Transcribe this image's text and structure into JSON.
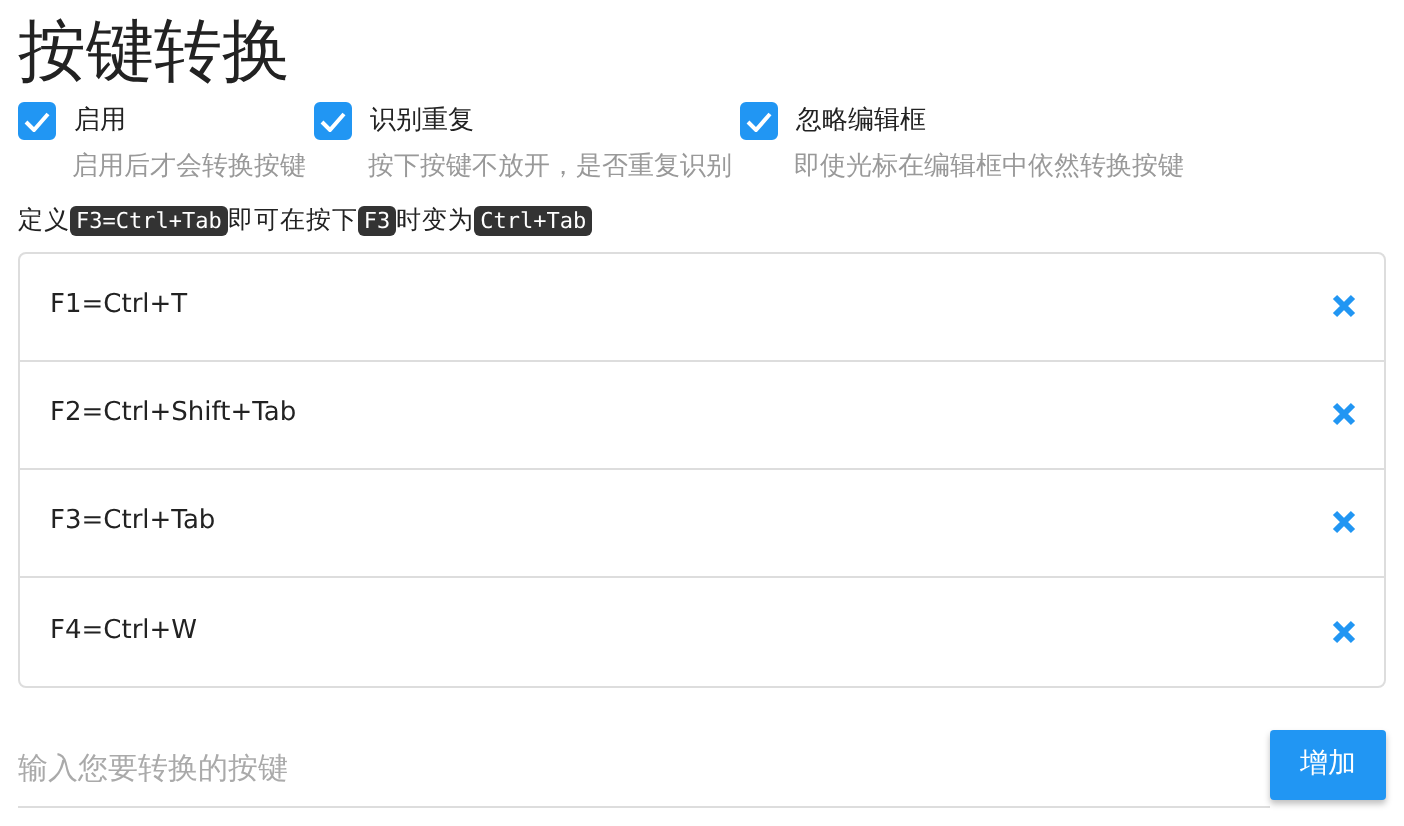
{
  "title": "按键转换",
  "options": [
    {
      "label": "启用",
      "hint": "启用后才会转换按键",
      "checked": true
    },
    {
      "label": "识别重复",
      "hint": "按下按键不放开，是否重复识别",
      "checked": true
    },
    {
      "label": "忽略编辑框",
      "hint": "即使光标在编辑框中依然转换按键",
      "checked": true
    }
  ],
  "help": [
    {
      "kind": "text",
      "text": "定义"
    },
    {
      "kind": "code",
      "text": "F3=Ctrl+Tab"
    },
    {
      "kind": "text",
      "text": "即可在按下"
    },
    {
      "kind": "code",
      "text": "F3"
    },
    {
      "kind": "text",
      "text": "时变为"
    },
    {
      "kind": "code",
      "text": "Ctrl+Tab"
    }
  ],
  "mappings": [
    {
      "text": "F1=Ctrl+T"
    },
    {
      "text": "F2=Ctrl+Shift+Tab"
    },
    {
      "text": "F3=Ctrl+Tab"
    },
    {
      "text": "F4=Ctrl+W"
    }
  ],
  "input": {
    "placeholder": "输入您要转换的按键"
  },
  "add_button": "增加"
}
